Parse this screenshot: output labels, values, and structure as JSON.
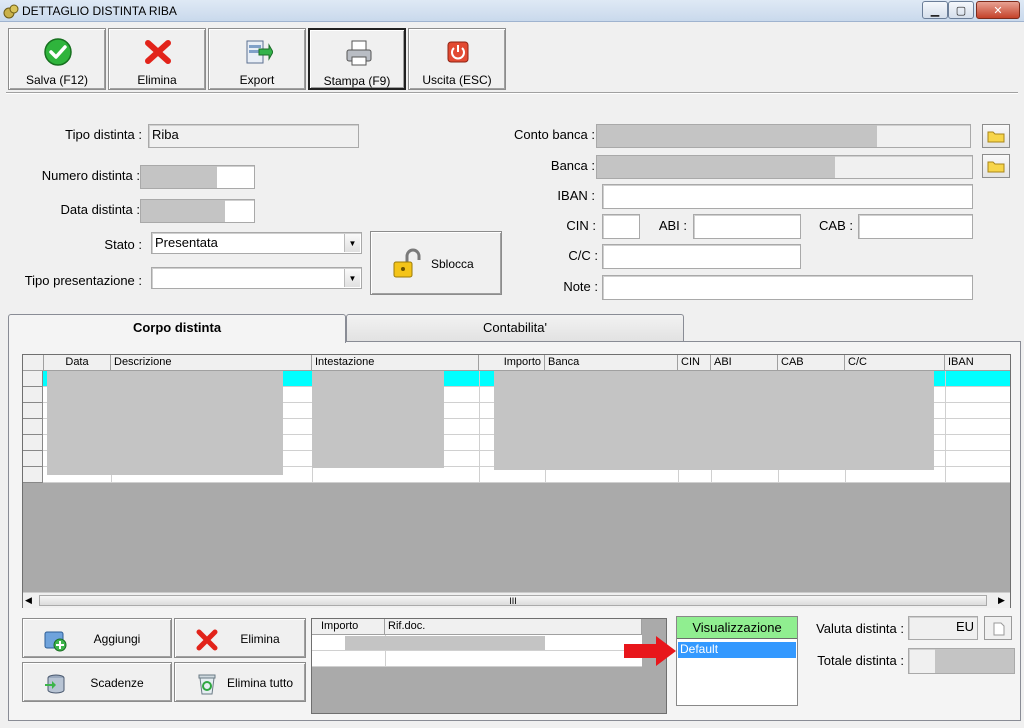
{
  "window": {
    "title": "DETTAGLIO DISTINTA RIBA",
    "min_glyph": "▁",
    "max_glyph": "▢",
    "close_glyph": "✕"
  },
  "toolbar": {
    "salva": "Salva (F12)",
    "elimina": "Elimina",
    "export": "Export",
    "stampa": "Stampa (F9)",
    "uscita": "Uscita (ESC)"
  },
  "form": {
    "tipo_distinta_label": "Tipo distinta :",
    "tipo_distinta_value": "Riba",
    "numero_distinta_label": "Numero distinta :",
    "data_distinta_label": "Data distinta :",
    "stato_label": "Stato :",
    "stato_value": "Presentata",
    "tipo_presentazione_label": "Tipo presentazione :",
    "tipo_presentazione_value": "",
    "sblocca": "Sblocca",
    "conto_banca_label": "Conto banca :",
    "banca_label": "Banca :",
    "iban_label": "IBAN :",
    "cin_label": "CIN :",
    "abi_label": "ABI :",
    "cab_label": "CAB :",
    "cc_label": "C/C :",
    "note_label": "Note :"
  },
  "tabs": {
    "corpo": "Corpo distinta",
    "contabilita": "Contabilita'"
  },
  "grid": {
    "columns": [
      "Data",
      "Descrizione",
      "Intestazione",
      "Importo",
      "Banca",
      "CIN",
      "ABI",
      "CAB",
      "C/C",
      "IBAN"
    ],
    "scroll_thumb": "III"
  },
  "bottom": {
    "aggiungi": "Aggiungi",
    "elimina": "Elimina",
    "scadenze": "Scadenze",
    "elimina_tutto": "Elimina tutto"
  },
  "subgrid": {
    "columns": [
      "Importo",
      "Rif.doc."
    ]
  },
  "visualizzazione": {
    "header": "Visualizzazione",
    "selected": "Default"
  },
  "totals": {
    "valuta_label": "Valuta distinta :",
    "valuta_value": "EU",
    "totale_label": "Totale distinta :"
  },
  "colors": {
    "selected_row": "#00ffff",
    "vis_header": "#90ee90",
    "vis_selected": "#3399ff",
    "redaction": "#c4c4c4"
  }
}
